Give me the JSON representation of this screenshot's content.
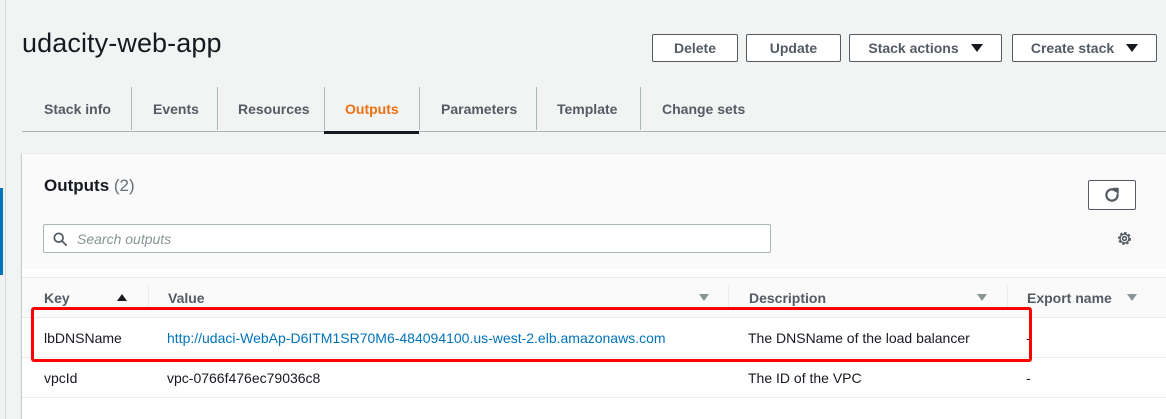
{
  "page": {
    "title": "udacity-web-app"
  },
  "header_buttons": {
    "delete": "Delete",
    "update": "Update",
    "stack_actions": "Stack actions",
    "create_stack": "Create stack"
  },
  "tabs": [
    {
      "label": "Stack info"
    },
    {
      "label": "Events"
    },
    {
      "label": "Resources"
    },
    {
      "label": "Outputs",
      "active": true
    },
    {
      "label": "Parameters"
    },
    {
      "label": "Template"
    },
    {
      "label": "Change sets"
    }
  ],
  "outputs": {
    "title": "Outputs",
    "count": "(2)",
    "search_placeholder": "Search outputs",
    "columns": {
      "key": "Key",
      "value": "Value",
      "description": "Description",
      "export_name": "Export name"
    },
    "rows": [
      {
        "key": "lbDNSName",
        "value": "http://udaci-WebAp-D6ITM1SR70M6-484094100.us-west-2.elb.amazonaws.com",
        "description": "The DNSName of the load balancer",
        "export_name": "-"
      },
      {
        "key": "vpcId",
        "value": "vpc-0766f476ec79036c8",
        "description": "The ID of the VPC",
        "export_name": "-"
      }
    ]
  },
  "colors": {
    "active_tab": "#ec7211",
    "link": "#0073bb",
    "highlight_box": "#ff0000"
  },
  "icons": [
    "refresh-icon",
    "search-icon",
    "gear-icon",
    "caret-down-icon",
    "sort-ascending-icon",
    "sort-icon"
  ]
}
